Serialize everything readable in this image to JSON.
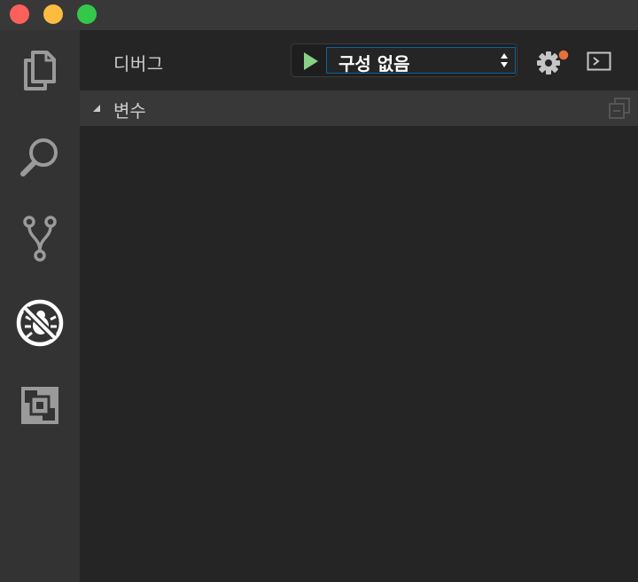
{
  "window": {
    "traffic_lights": {
      "close_color": "#fc605b",
      "minimize_color": "#fdbc40",
      "maximize_color": "#34c84a"
    }
  },
  "activity_bar": {
    "items": [
      {
        "icon": "files-icon"
      },
      {
        "icon": "search-icon"
      },
      {
        "icon": "source-control-icon"
      },
      {
        "icon": "debug-icon",
        "active": true
      },
      {
        "icon": "extensions-icon"
      }
    ]
  },
  "debug": {
    "title": "디버그",
    "configuration": "구성 없음",
    "start_icon": "play-icon",
    "settings_icon": "gear-icon",
    "settings_badge_color": "#e8703a",
    "console_icon": "console-icon",
    "play_color": "#89d185"
  },
  "variables": {
    "label": "변수",
    "expanded": true
  }
}
